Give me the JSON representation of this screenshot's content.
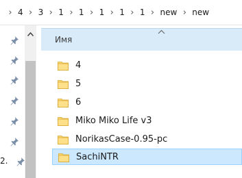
{
  "breadcrumb": {
    "segments": [
      "4",
      "3",
      "1",
      "1",
      "1",
      "1",
      "1",
      "new",
      "new"
    ]
  },
  "nav": {
    "partial_item_text": "2.",
    "pin_icon": "pin-icon"
  },
  "columns": {
    "name_label": "Имя"
  },
  "files": [
    {
      "name": "4",
      "icon": "folder-icon"
    },
    {
      "name": "5",
      "icon": "folder-icon"
    },
    {
      "name": "6",
      "icon": "folder-icon"
    },
    {
      "name": "Miko Miko Life v3",
      "icon": "folder-icon"
    },
    {
      "name": "NorikasCase-0.95-pc",
      "icon": "folder-icon"
    },
    {
      "name": "SachiNTR",
      "icon": "folder-icon",
      "selected": true
    }
  ],
  "colors": {
    "selection_bg": "#cce8ff",
    "selection_border": "#99d1ff",
    "header_bg": "#d9ebf9",
    "folder_yellow": "#f8d775"
  }
}
